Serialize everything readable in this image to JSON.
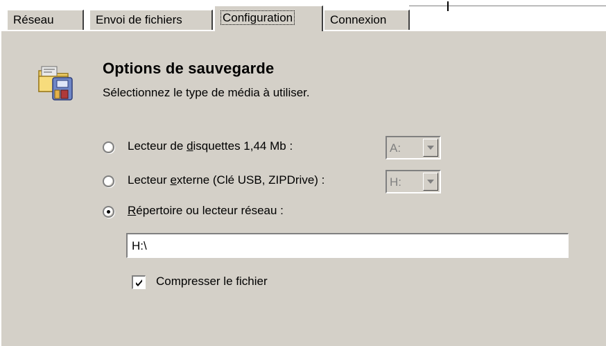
{
  "tabs": [
    {
      "label": "Réseau"
    },
    {
      "label": "Envoi de fichiers"
    },
    {
      "label": "Configuration",
      "active": true
    },
    {
      "label": "Connexion"
    }
  ],
  "section": {
    "icon": "backup-options-icon",
    "title": "Options de sauvegarde",
    "subtitle": "Sélectionnez le type de média à utiliser."
  },
  "options": {
    "floppy": {
      "label_pre": "Lecteur de ",
      "label_u": "d",
      "label_post": "isquettes 1,44 Mb :",
      "selected": false,
      "drive": "A:"
    },
    "external": {
      "label_pre": "Lecteur ",
      "label_u": "e",
      "label_post": "xterne (Clé USB, ZIPDrive) :",
      "selected": false,
      "drive": "H:"
    },
    "directory": {
      "label_pre": "",
      "label_u": "R",
      "label_post": "épertoire ou lecteur réseau :",
      "selected": true
    }
  },
  "path": {
    "value": "H:\\"
  },
  "compress": {
    "label": "Compresser le fichier",
    "checked": true
  },
  "colors": {
    "face": "#d4d0c8",
    "shadow": "#808080",
    "highlight": "#ffffff"
  }
}
